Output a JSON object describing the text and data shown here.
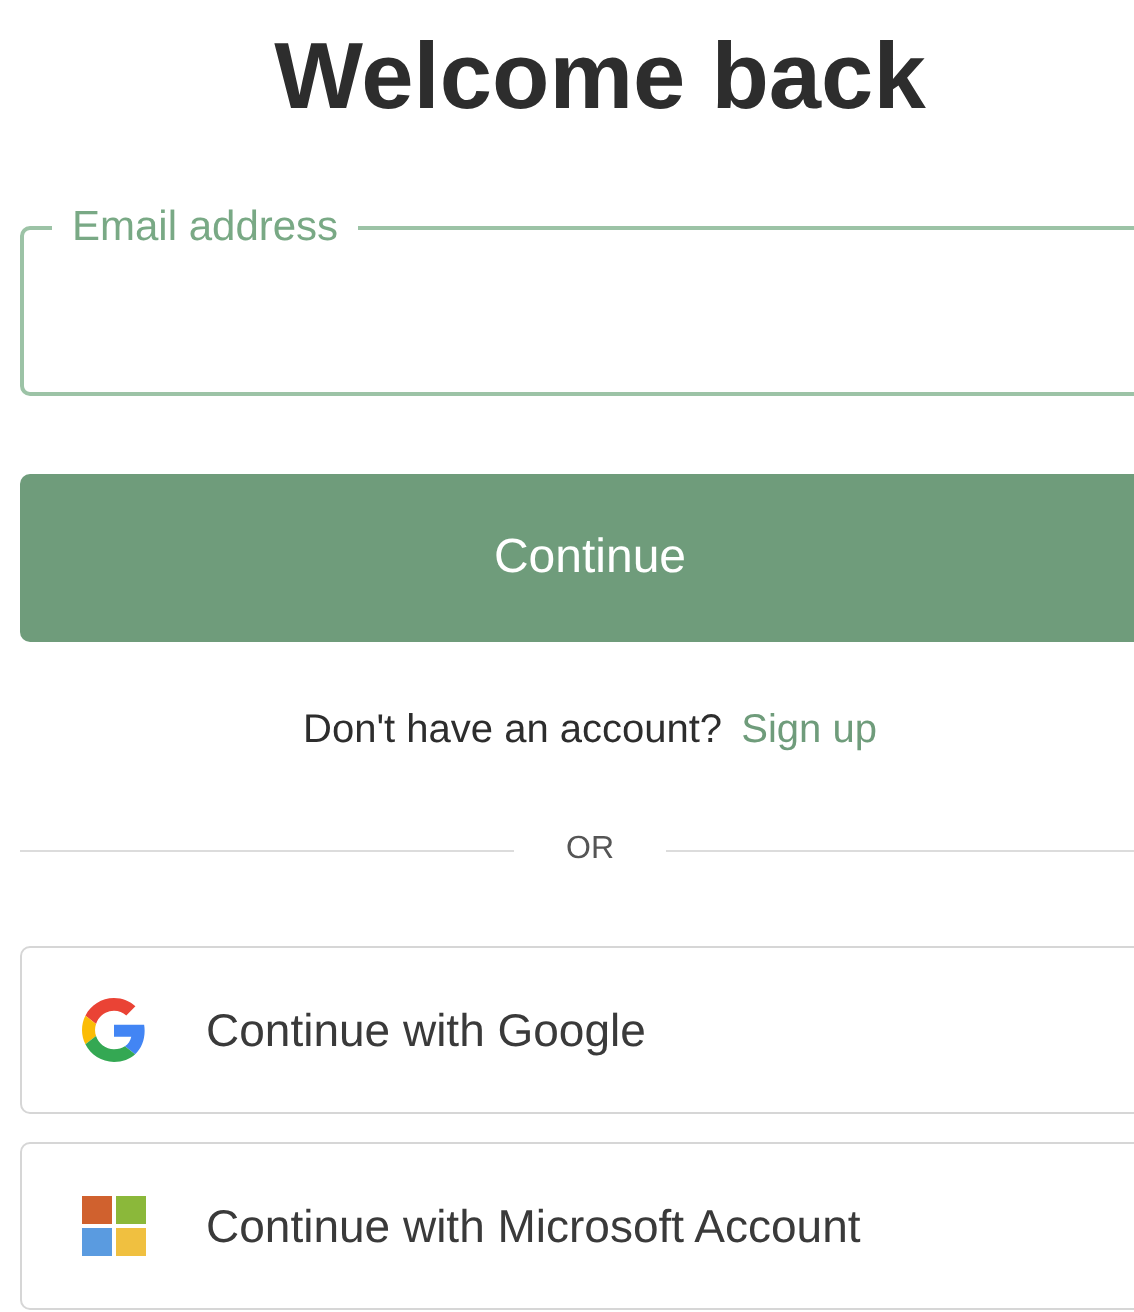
{
  "title": "Welcome back",
  "email_field": {
    "label": "Email address"
  },
  "continue_button": {
    "label": "Continue"
  },
  "signup_prompt": {
    "text": "Don't have an account?",
    "link": "Sign up"
  },
  "divider": {
    "label": "OR"
  },
  "social_buttons": [
    {
      "kind": "google",
      "label": "Continue with Google"
    },
    {
      "kind": "microsoft",
      "label": "Continue with Microsoft Account"
    }
  ]
}
